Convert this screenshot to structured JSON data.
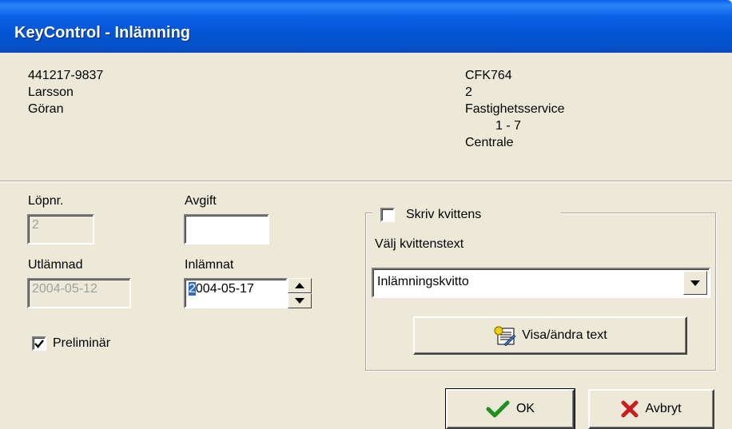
{
  "window": {
    "title": "KeyControl - Inlämning"
  },
  "person": {
    "id": "441217-9837",
    "last_name": "Larsson",
    "first_name": "Göran"
  },
  "key": {
    "code": "CFK764",
    "count": "2",
    "department": "Fastighetsservice",
    "range": "1 - 7",
    "location": "Centrale"
  },
  "fields": {
    "lopnr_label": "Löpnr.",
    "lopnr_value": "2",
    "avgift_label": "Avgift",
    "avgift_value": "",
    "utlamnad_label": "Utlämnad",
    "utlamnad_value": "2004-05-12",
    "inlamnat_label": "Inlämnat",
    "inlamnat_value_first": "2",
    "inlamnat_value_rest": "004-05-17"
  },
  "preliminar": {
    "label": "Preliminär",
    "checked": true
  },
  "receipt": {
    "print_label": "Skriv kvittens",
    "print_checked": false,
    "choose_label": "Välj kvittenstext",
    "selected_text": "Inlämningskvitto",
    "edit_button": "Visa/ändra text"
  },
  "buttons": {
    "ok": "OK",
    "cancel": "Avbryt"
  }
}
